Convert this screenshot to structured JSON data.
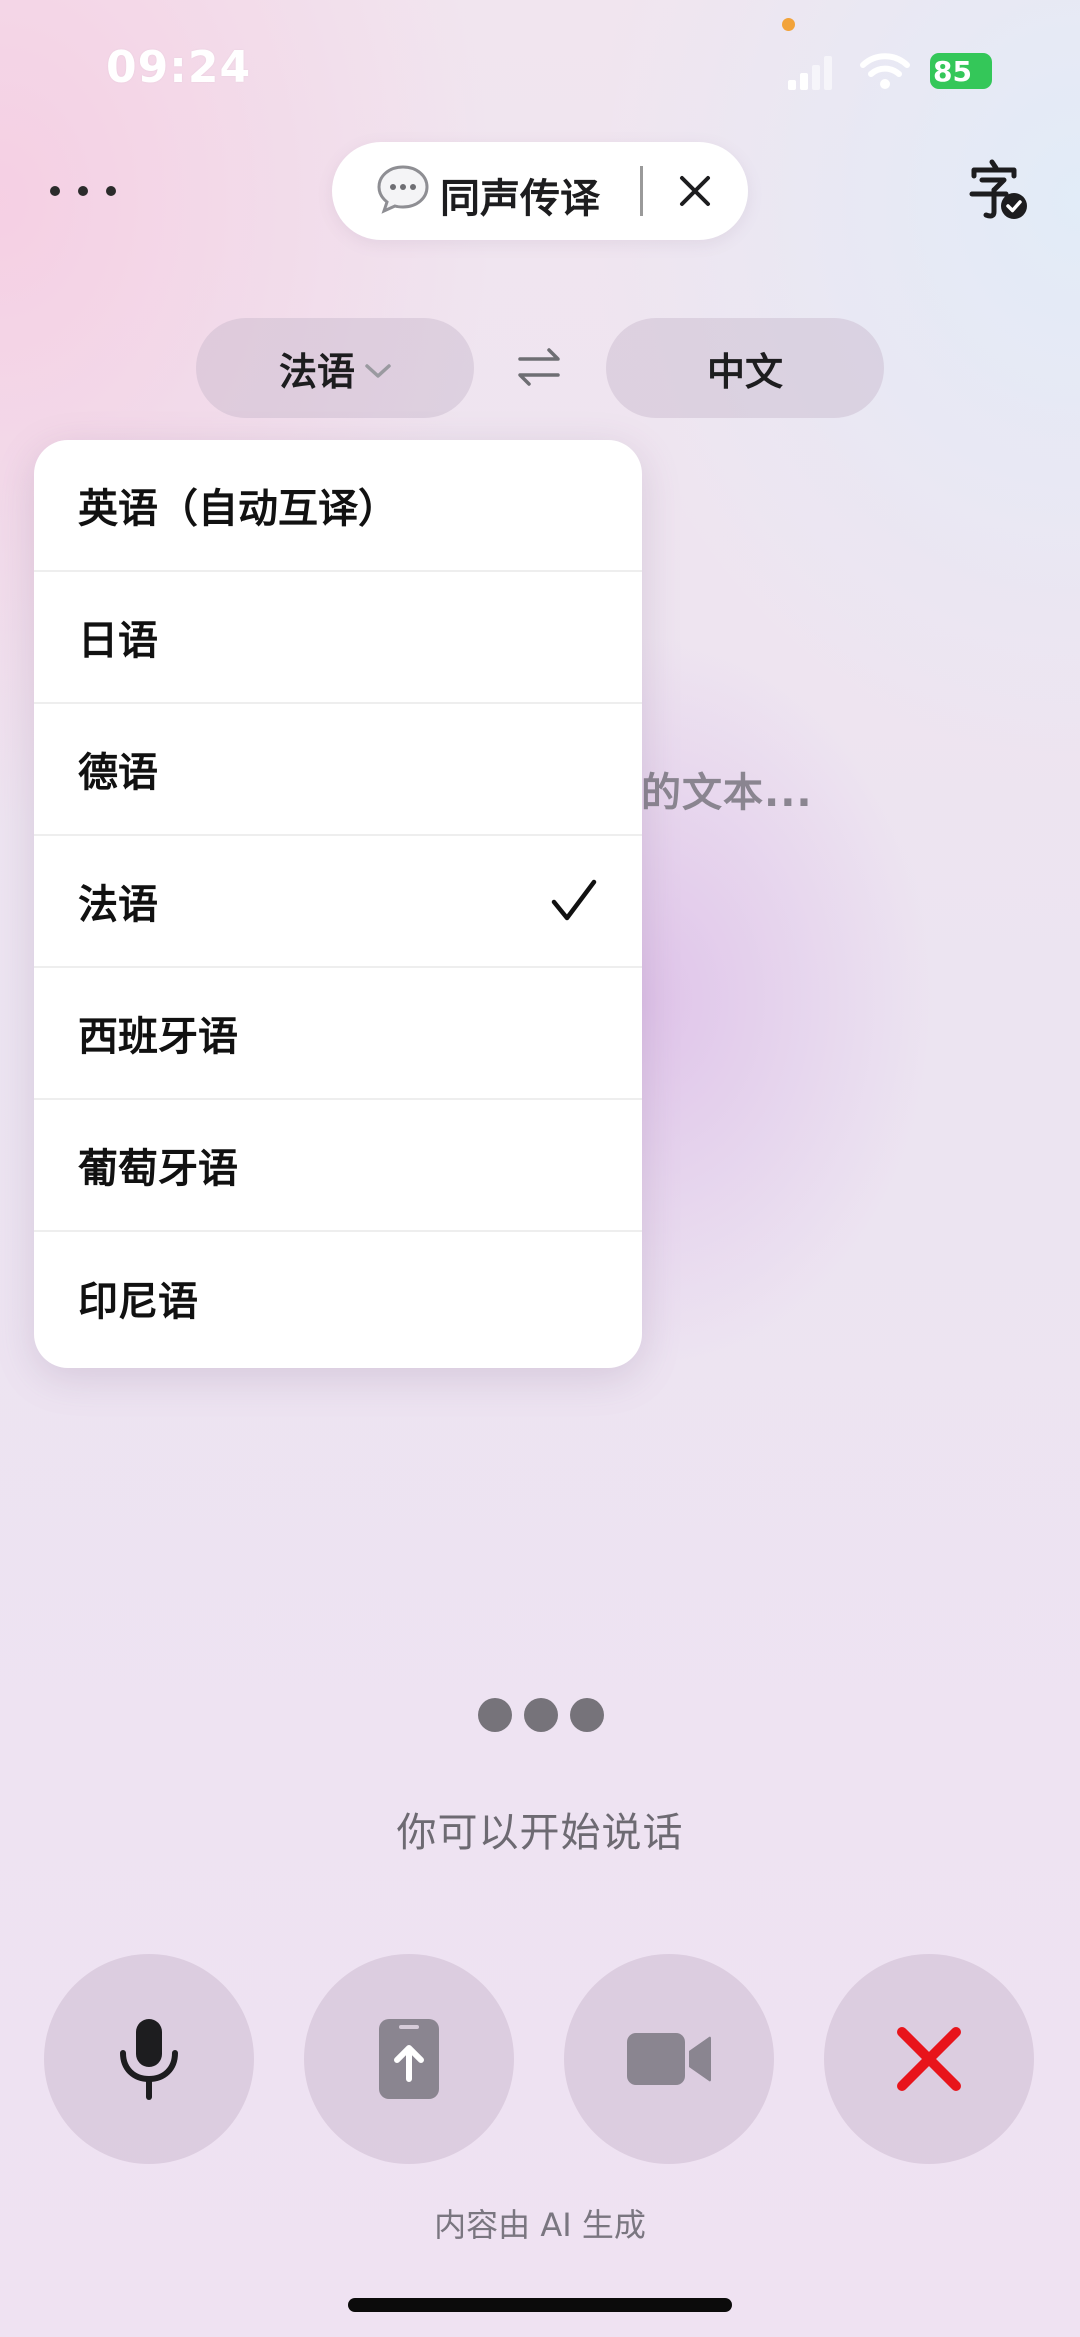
{
  "status_bar": {
    "time": "09:24",
    "battery": "85"
  },
  "header": {
    "mode_label": "同声传译"
  },
  "languages": {
    "source": "法语",
    "target": "中文"
  },
  "background_text": "话的文本...",
  "dropdown": {
    "items": [
      {
        "label": "英语（自动互译）"
      },
      {
        "label": "日语"
      },
      {
        "label": "德语"
      },
      {
        "label": "法语",
        "selected": true
      },
      {
        "label": "西班牙语"
      },
      {
        "label": "葡萄牙语"
      },
      {
        "label": "印尼语"
      }
    ]
  },
  "prompt": "你可以开始说话",
  "footer": {
    "ai_note": "内容由 AI 生成"
  },
  "colors": {
    "accent_red": "#e8141b",
    "battery_green": "#34c759"
  }
}
